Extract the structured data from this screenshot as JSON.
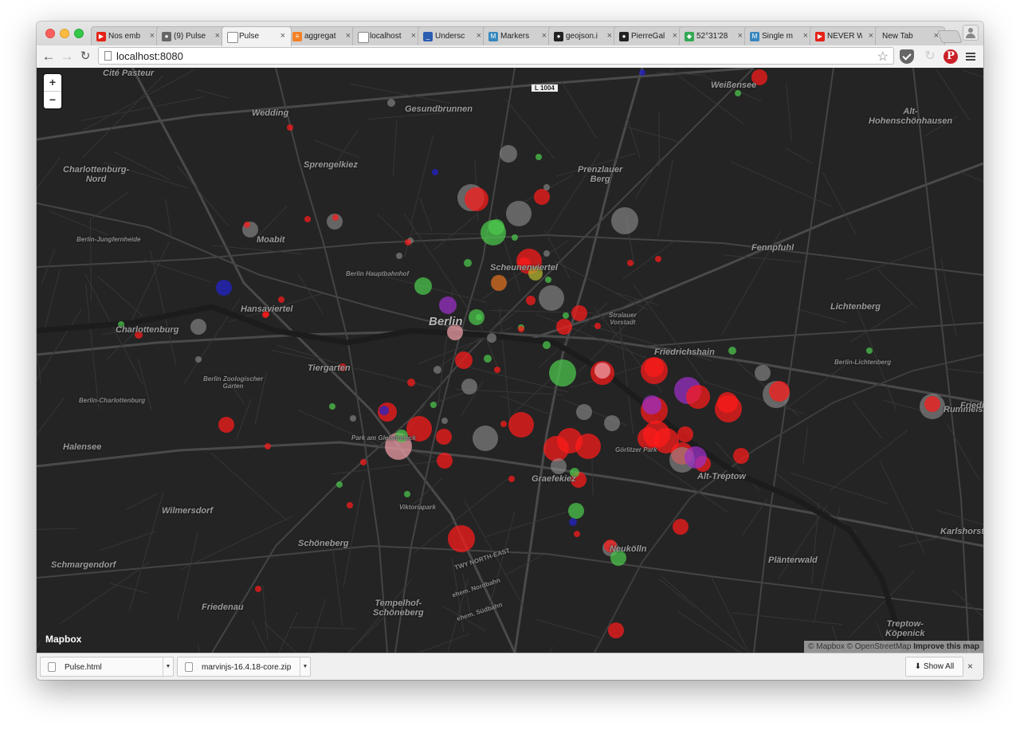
{
  "browser": {
    "tabs": [
      {
        "title": "Nos emb",
        "icon": "youtube-icon",
        "color": "#e62117"
      },
      {
        "title": "(9) Pulse",
        "icon": "notification-favicon-icon",
        "color": "#666666"
      },
      {
        "title": "Pulse",
        "icon": "page-icon",
        "color": "#999999",
        "active": true
      },
      {
        "title": "aggregat",
        "icon": "stack-icon",
        "color": "#f48024"
      },
      {
        "title": "localhost",
        "icon": "page-icon",
        "color": "#999999"
      },
      {
        "title": "Undersc",
        "icon": "underscore-icon",
        "color": "#2a5db0"
      },
      {
        "title": "Markers",
        "icon": "mapbox-m-icon",
        "color": "#3887be"
      },
      {
        "title": "geojson.i",
        "icon": "github-count-icon",
        "color": "#222222"
      },
      {
        "title": "PierreGal",
        "icon": "github-icon",
        "color": "#222222"
      },
      {
        "title": "52°31'28",
        "icon": "google-maps-icon",
        "color": "#34a853"
      },
      {
        "title": "Single m",
        "icon": "mapbox-m-icon",
        "color": "#3887be"
      },
      {
        "title": "NEVER W",
        "icon": "youtube-icon",
        "color": "#e62117"
      },
      {
        "title": "New Tab",
        "icon": "",
        "color": ""
      }
    ],
    "tab_close_glyph": "×",
    "address": "localhost:8080"
  },
  "map": {
    "zoom_in": "+",
    "zoom_out": "−",
    "logo": "Mapbox",
    "attribution": {
      "mapbox": "© Mapbox",
      "osm": "© OpenStreetMap",
      "improve": "Improve this map"
    },
    "labels": [
      {
        "text": "Cité Pasteur",
        "kind": "district"
      },
      {
        "text": "Wedding",
        "kind": "district"
      },
      {
        "text": "Gesundbrunnen",
        "kind": "district"
      },
      {
        "text": "Weißensee",
        "kind": "district"
      },
      {
        "text": "Alt-Hohenschönhausen",
        "kind": "district"
      },
      {
        "text": "Charlottenburg-Nord",
        "kind": "district"
      },
      {
        "text": "Sprengelkiez",
        "kind": "district"
      },
      {
        "text": "Prenzlauer Berg",
        "kind": "district"
      },
      {
        "text": "Berlin-Jungfernheide",
        "kind": "station"
      },
      {
        "text": "Moabit",
        "kind": "district"
      },
      {
        "text": "Fennpfuhl",
        "kind": "district"
      },
      {
        "text": "Berlin Hauptbahnhof",
        "kind": "station"
      },
      {
        "text": "Scheunenviertel",
        "kind": "district"
      },
      {
        "text": "Hansaviertel",
        "kind": "district"
      },
      {
        "text": "Lichtenberg",
        "kind": "district"
      },
      {
        "text": "Charlottenburg",
        "kind": "district"
      },
      {
        "text": "Berlin",
        "kind": "city"
      },
      {
        "text": "Stralauer Vorstadt",
        "kind": "district-small"
      },
      {
        "text": "Friedrichshain",
        "kind": "district"
      },
      {
        "text": "Tiergarten",
        "kind": "district"
      },
      {
        "text": "Berlin Zoologischer Garten",
        "kind": "station"
      },
      {
        "text": "Berlin-Lichtenberg",
        "kind": "station"
      },
      {
        "text": "Berlin-Charlottenburg",
        "kind": "station"
      },
      {
        "text": "Rummelsburg",
        "kind": "district"
      },
      {
        "text": "Friedrichsfelde",
        "kind": "district"
      },
      {
        "text": "Halensee",
        "kind": "district"
      },
      {
        "text": "Park am Gleisdreieck",
        "kind": "park"
      },
      {
        "text": "Görlitzer Park",
        "kind": "park"
      },
      {
        "text": "Graefekiez",
        "kind": "district"
      },
      {
        "text": "Alt-Treptow",
        "kind": "district"
      },
      {
        "text": "Wilmersdorf",
        "kind": "district"
      },
      {
        "text": "Viktoriapark",
        "kind": "park"
      },
      {
        "text": "Schöneberg",
        "kind": "district"
      },
      {
        "text": "Neukölln",
        "kind": "district"
      },
      {
        "text": "Karlshorst",
        "kind": "district"
      },
      {
        "text": "Schmargendorf",
        "kind": "district"
      },
      {
        "text": "Plänterwald",
        "kind": "district"
      },
      {
        "text": "Friedenau",
        "kind": "district"
      },
      {
        "text": "Tempelhof-Schöneberg",
        "kind": "district"
      },
      {
        "text": "Treptow-Köpenick",
        "kind": "district"
      },
      {
        "text": "TWY NORTH-EAST",
        "kind": "street"
      },
      {
        "text": "ehem. Nordbahn",
        "kind": "street"
      },
      {
        "text": "ehem. Südbahn",
        "kind": "street"
      },
      {
        "text": "L 1004",
        "kind": "shield"
      }
    ],
    "marker_colors": {
      "red": "#ff1a1a",
      "green": "#4cc94c",
      "blue": "#2222cc",
      "grey": "#9a9a9a",
      "pink": "#f0a0a8",
      "purple": "#9b30c8",
      "orange": "#e07020",
      "olive": "#b8b830"
    }
  },
  "downloads": {
    "items": [
      {
        "name": "Pulse.html"
      },
      {
        "name": "marvinjs-16.4.18-core.zip"
      }
    ],
    "show_all": "Show All",
    "close": "×"
  }
}
